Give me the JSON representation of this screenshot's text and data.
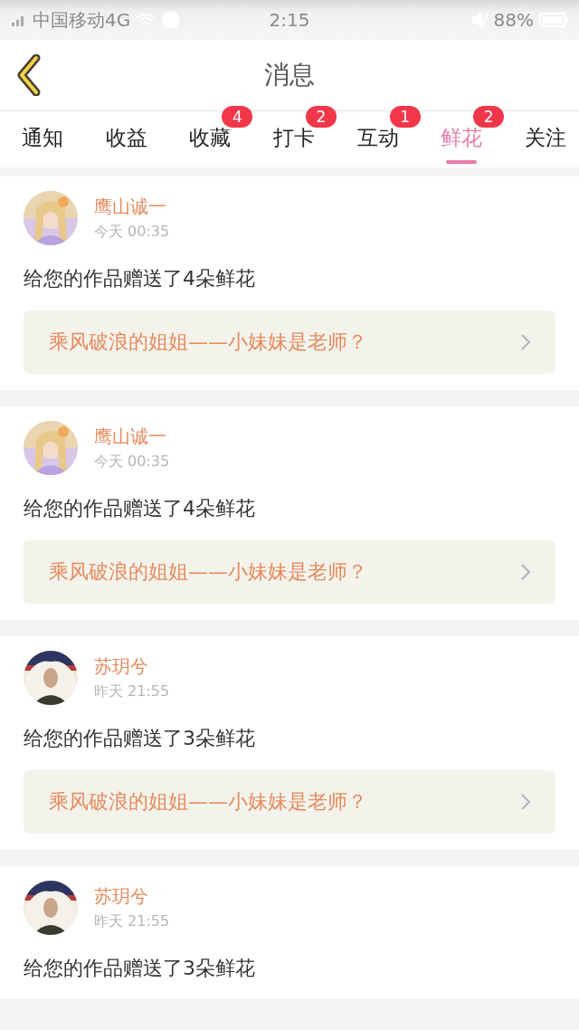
{
  "status_bar": {
    "carrier": "中国移动4G",
    "time": "2:15",
    "battery": "88%"
  },
  "header": {
    "title": "消息"
  },
  "tabs": [
    {
      "label": "通知",
      "selected": false
    },
    {
      "label": "收益",
      "selected": false
    },
    {
      "label": "收藏",
      "selected": false,
      "badge": "4"
    },
    {
      "label": "打卡",
      "selected": false,
      "badge": "2"
    },
    {
      "label": "互动",
      "selected": false,
      "badge": "1"
    },
    {
      "label": "鲜花",
      "selected": true,
      "badge": "2"
    },
    {
      "label": "关注",
      "selected": false
    }
  ],
  "messages": [
    {
      "user": "鹰山诚一",
      "time": "今天 00:35",
      "text": "给您的作品赠送了4朵鲜花",
      "work_title": "乘风破浪的姐姐——小妹妹是老师？"
    },
    {
      "user": "鹰山诚一",
      "time": "今天 00:35",
      "text": "给您的作品赠送了4朵鲜花",
      "work_title": "乘风破浪的姐姐——小妹妹是老师？"
    },
    {
      "user": "苏玥兮",
      "time": "昨天 21:55",
      "text": "给您的作品赠送了3朵鲜花",
      "work_title": "乘风破浪的姐姐——小妹妹是老师？"
    },
    {
      "user": "苏玥兮",
      "time": "昨天 21:55",
      "text": "给您的作品赠送了3朵鲜花"
    }
  ]
}
